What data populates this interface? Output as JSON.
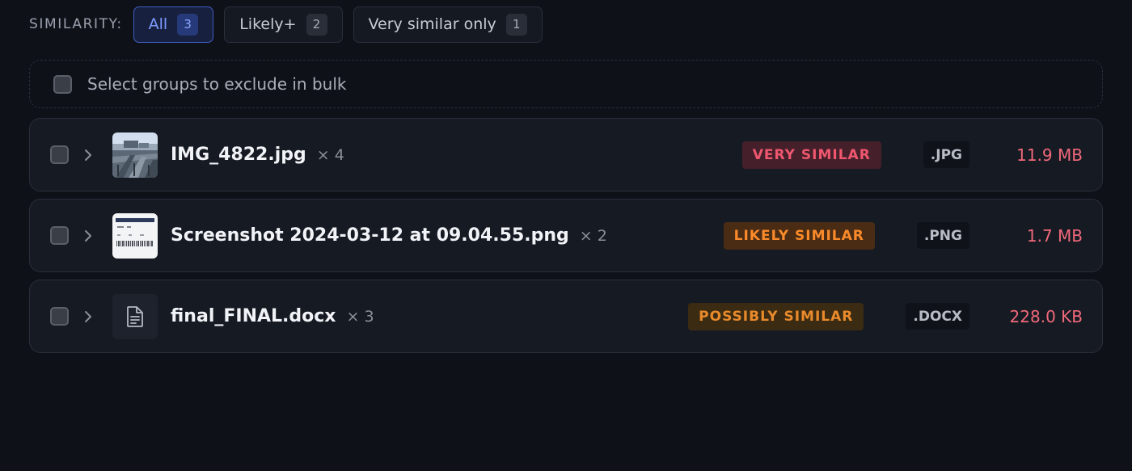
{
  "filters": {
    "label": "SIMILARITY:",
    "options": [
      {
        "label": "All",
        "count": "3",
        "active": true
      },
      {
        "label": "Likely+",
        "count": "2",
        "active": false
      },
      {
        "label": "Very similar only",
        "count": "1",
        "active": false
      }
    ]
  },
  "bulk": {
    "label": "Select groups to exclude in bulk"
  },
  "groups": [
    {
      "name": "IMG_4822.jpg",
      "count": "× 4",
      "badge": "VERY SIMILAR",
      "badge_level": "very",
      "ext": ".JPG",
      "size": "11.9 MB",
      "thumb": "photo-thumbnail"
    },
    {
      "name": "Screenshot 2024-03-12 at 09.04.55.png",
      "count": "× 2",
      "badge": "LIKELY SIMILAR",
      "badge_level": "likely",
      "ext": ".PNG",
      "size": "1.7 MB",
      "thumb": "screenshot-thumbnail"
    },
    {
      "name": "final_FINAL.docx",
      "count": "× 3",
      "badge": "POSSIBLY SIMILAR",
      "badge_level": "possibly",
      "ext": ".DOCX",
      "size": "228.0 KB",
      "thumb": "document-icon"
    }
  ],
  "colors": {
    "background": "#0f1119",
    "accent": "#7c9bff",
    "size_text": "#f0697a",
    "very_similar": "#f0576f",
    "likely_similar": "#fb8a2a",
    "possibly_similar": "#e98a2b"
  }
}
